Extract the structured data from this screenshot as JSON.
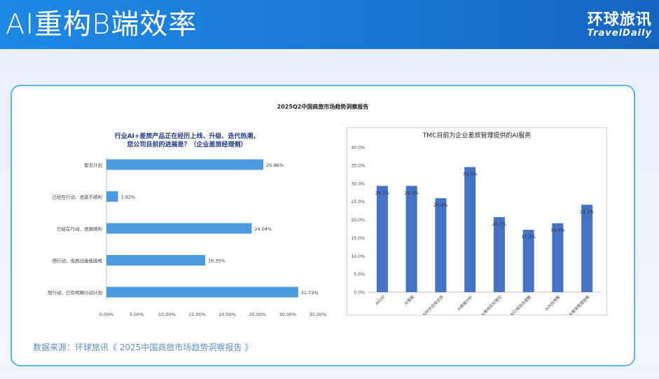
{
  "header": {
    "title": "AI重构B端效率",
    "logo_cn": "环球旅讯",
    "logo_en": "TravelDaily"
  },
  "card": {
    "report_title": "2025Q2中国商旅市场趋势洞察报告",
    "source": "数据来源：环球旅讯《 2025中国商旅市场趋势洞察报告 》"
  },
  "colors": {
    "left_bar": "#4a9be0",
    "right_bar": "#4472c4",
    "header": "#1e88e5"
  },
  "chart_data": [
    {
      "type": "bar",
      "orientation": "horizontal",
      "title_lines": [
        "行业AI+差旅产品正在经历上线、升级、迭代热潮，",
        "您公司目前的进展是？（企业差旅经理侧）"
      ],
      "categories": [
        "暂无计划",
        "已经在行动、进展不顺利",
        "已经在行动、进展顺利",
        "想行动、但启动面临困难",
        "想行动，已有明确行动计划"
      ],
      "values": [
        25.96,
        1.92,
        24.04,
        16.35,
        31.73
      ],
      "value_labels": [
        "25.96%",
        "1.92%",
        "24.04%",
        "16.35%",
        "31.73%"
      ],
      "xlim": [
        0,
        35
      ],
      "ticks": [
        "0.00%",
        "5.00%",
        "10.00%",
        "15.00%",
        "20.00%",
        "25.00%",
        "30.00%",
        "35.00%"
      ],
      "grid": false
    },
    {
      "type": "bar",
      "title": "TMC目前为企业差旅管理提供的AI服务",
      "categories": [
        "AI比价",
        "AI客服",
        "AI财务合规支持",
        "AI数据分析",
        "AI差标实时管控",
        "AI行程动态提醒",
        "AI风险预警",
        "AI差旅管理政策"
      ],
      "values": [
        29.3,
        29.3,
        25.9,
        34.5,
        20.7,
        17.2,
        19.0,
        24.1
      ],
      "value_labels": [
        "29.3%",
        "29.3%",
        "25.9%",
        "34.5%",
        "20.7%",
        "17.2%",
        "19.0%",
        "24.1%"
      ],
      "ylim": [
        0,
        40
      ],
      "ticks": [
        "0.0%",
        "5.0%",
        "10.0%",
        "15.0%",
        "20.0%",
        "25.0%",
        "30.0%",
        "35.0%",
        "40.0%"
      ],
      "grid": false
    }
  ]
}
